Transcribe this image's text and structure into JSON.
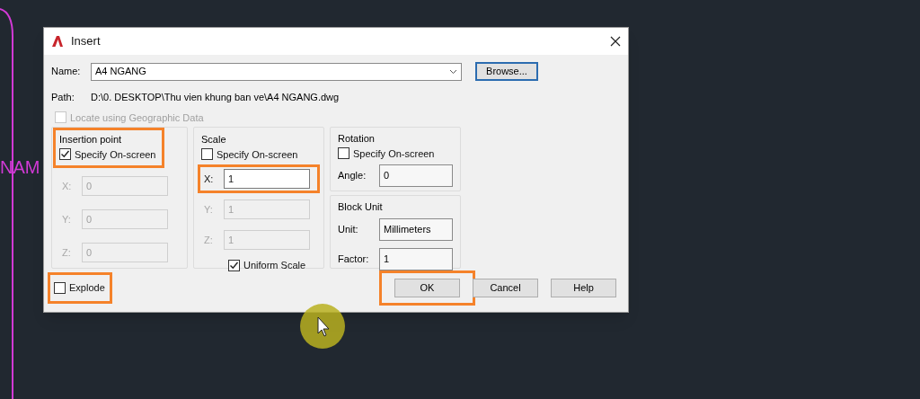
{
  "canvas": {
    "label": "NAM"
  },
  "dialog": {
    "title": "Insert",
    "name": {
      "label": "Name:",
      "value": "A4 NGANG"
    },
    "browse": {
      "label": "Browse..."
    },
    "path": {
      "label": "Path:",
      "value": "D:\\0. DESKTOP\\Thu vien khung ban ve\\A4 NGANG.dwg"
    },
    "locate": {
      "label": "Locate using Geographic Data",
      "checked": false,
      "disabled": true
    },
    "insertion_point": {
      "title": "Insertion point",
      "highlighted": true,
      "specify": {
        "label": "Specify On-screen",
        "checked": true
      },
      "fields": [
        {
          "label": "X:",
          "value": "0",
          "disabled": true,
          "highlighted": false
        },
        {
          "label": "Y:",
          "value": "0",
          "disabled": true,
          "highlighted": false
        },
        {
          "label": "Z:",
          "value": "0",
          "disabled": true,
          "highlighted": false
        }
      ]
    },
    "scale": {
      "title": "Scale",
      "specify": {
        "label": "Specify On-screen",
        "checked": false
      },
      "fields": [
        {
          "label": "X:",
          "value": "1",
          "disabled": false,
          "highlighted": true
        },
        {
          "label": "Y:",
          "value": "1",
          "disabled": true,
          "highlighted": false
        },
        {
          "label": "Z:",
          "value": "1",
          "disabled": true,
          "highlighted": false
        }
      ],
      "uniform": {
        "label": "Uniform Scale",
        "checked": true
      }
    },
    "rotation": {
      "title": "Rotation",
      "specify": {
        "label": "Specify On-screen",
        "checked": false
      },
      "angle": {
        "label": "Angle:",
        "value": "0"
      }
    },
    "block_unit": {
      "title": "Block Unit",
      "unit": {
        "label": "Unit:",
        "value": "Millimeters"
      },
      "factor": {
        "label": "Factor:",
        "value": "1"
      }
    },
    "explode": {
      "label": "Explode",
      "checked": false,
      "highlighted": true
    },
    "buttons": [
      {
        "label": "OK",
        "highlighted": true
      },
      {
        "label": "Cancel",
        "highlighted": false
      },
      {
        "label": "Help",
        "highlighted": false
      }
    ]
  }
}
